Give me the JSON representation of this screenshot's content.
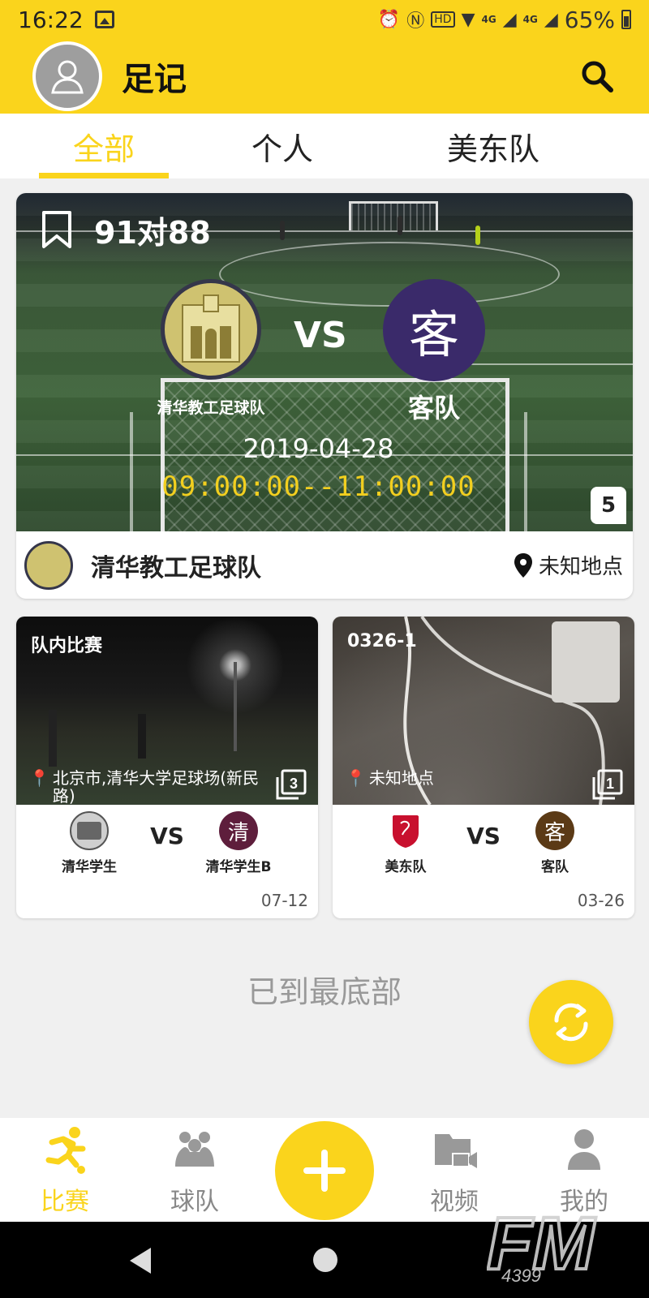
{
  "status_bar": {
    "time": "16:22",
    "net_1": "4G",
    "net_2": "4G",
    "battery": "65%"
  },
  "header": {
    "title": "足记"
  },
  "tabs": [
    {
      "label": "全部",
      "active": true
    },
    {
      "label": "个人"
    },
    {
      "label": "美东队"
    }
  ],
  "featured_match": {
    "title": "91对88",
    "home_team": "清华教工足球队",
    "vs": "VS",
    "away_team": "客队",
    "away_badge": "客",
    "date": "2019-04-28",
    "time_range": "09:00:00--11:00:00",
    "photo_count": "5",
    "owner_team": "清华教工足球队",
    "location": "未知地点"
  },
  "matches": [
    {
      "title": "队内比赛",
      "location": "北京市,清华大学足球场(新民路)",
      "photo_count": "3",
      "home": "清华学生",
      "vs": "VS",
      "away": "清华学生B",
      "away_badge": "清",
      "date": "07-12"
    },
    {
      "title": "0326-1",
      "location": "未知地点",
      "photo_count": "1",
      "home": "美东队",
      "vs": "VS",
      "away": "客队",
      "away_badge": "客",
      "date": "03-26"
    }
  ],
  "end_text": "已到最底部",
  "bottom_nav": [
    {
      "label": "比赛",
      "icon": "runner-icon",
      "active": true
    },
    {
      "label": "球队",
      "icon": "team-icon"
    },
    {
      "label": "视频",
      "icon": "video-folder-icon"
    },
    {
      "label": "我的",
      "icon": "person-icon"
    }
  ],
  "watermark": {
    "brand": "FM",
    "sub": "4399"
  },
  "colors": {
    "accent": "#fad41c",
    "time_digits": "#f2cf1f",
    "away_purple": "#3a2a6a",
    "maroon": "#5e1e3c"
  }
}
